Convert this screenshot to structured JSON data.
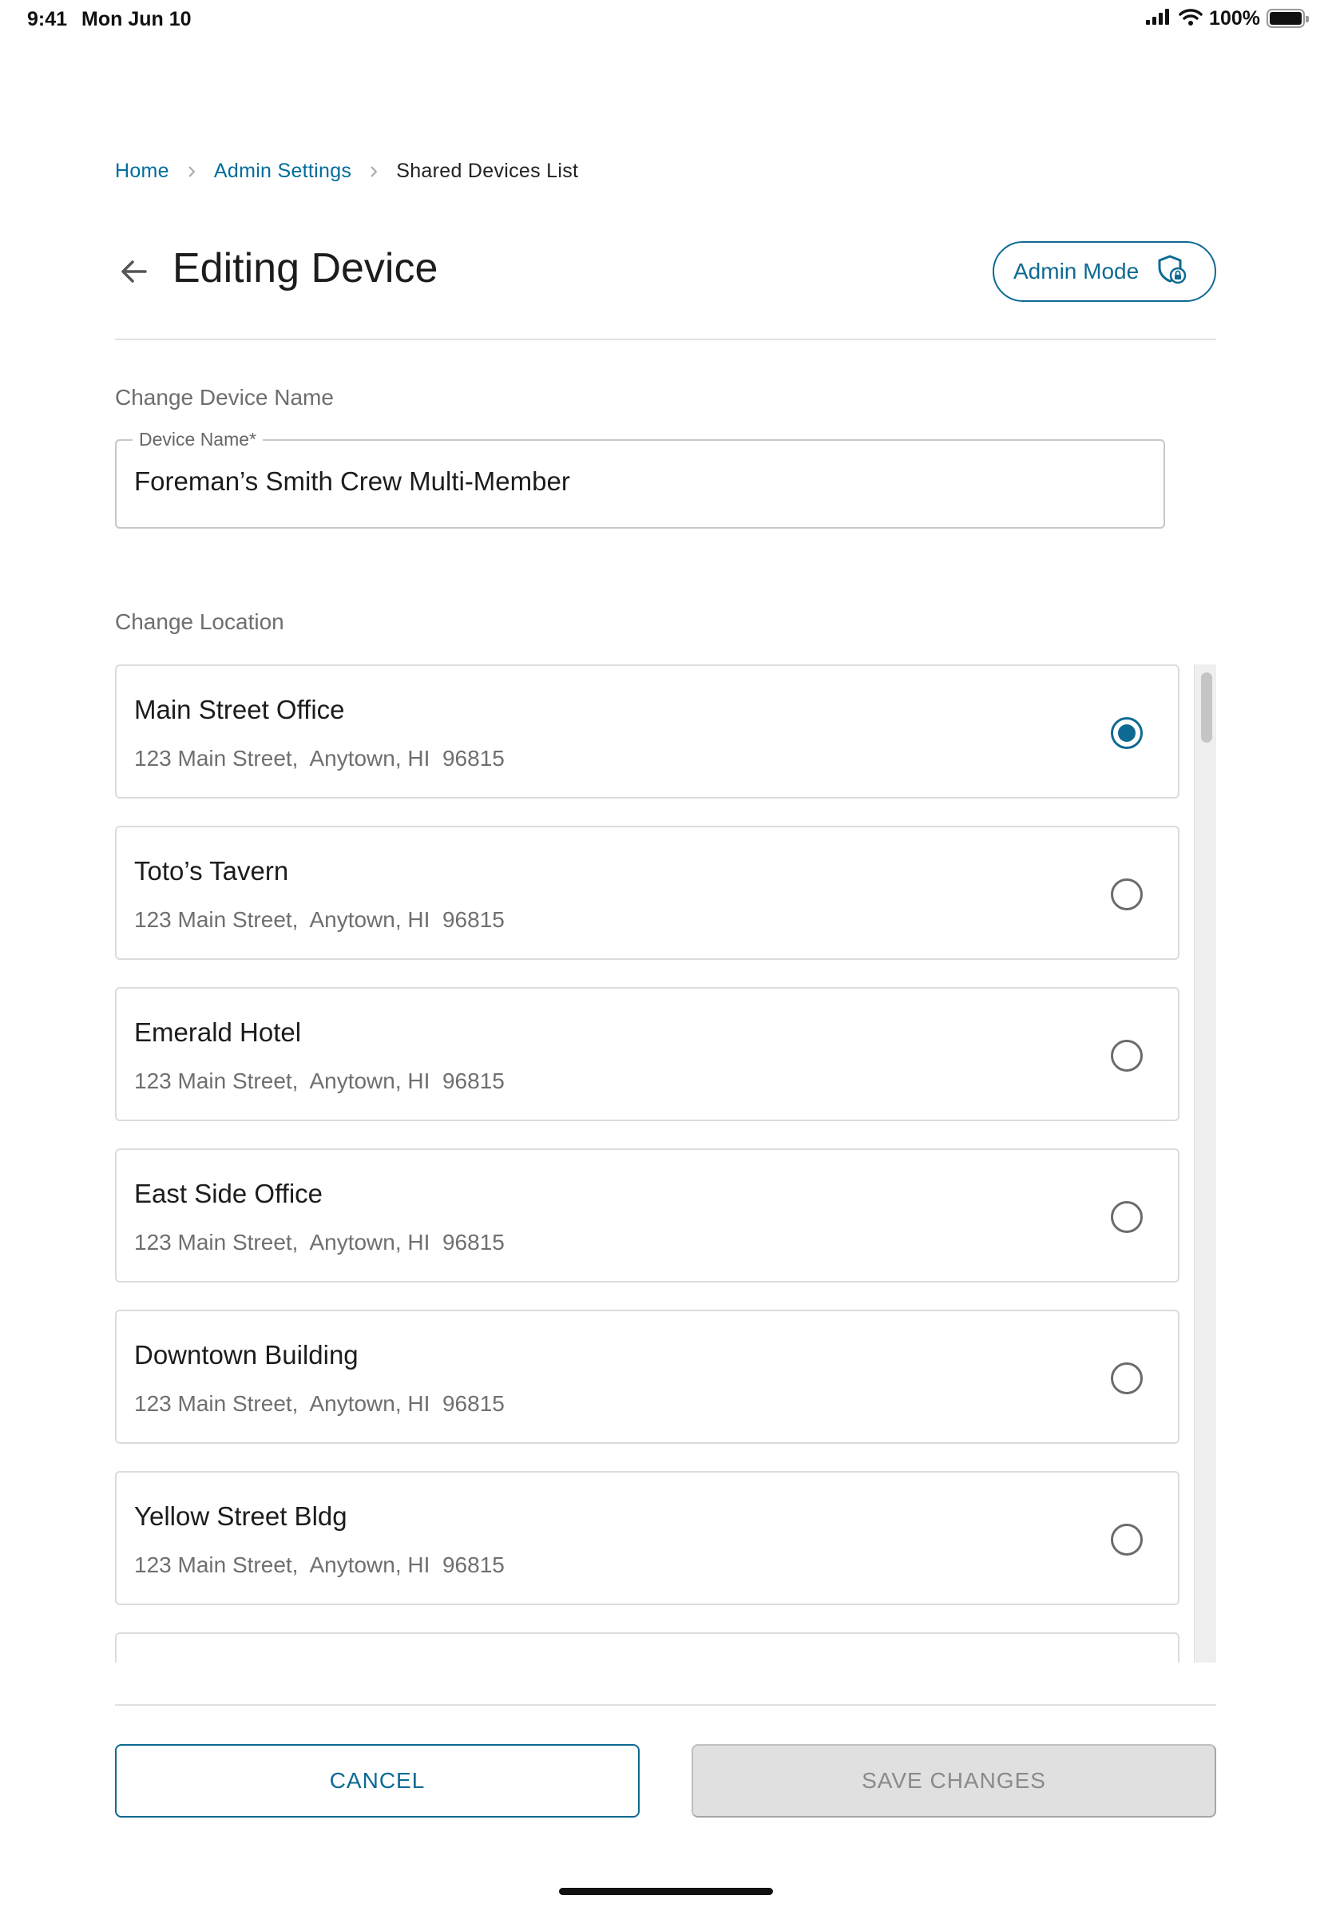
{
  "status_bar": {
    "time": "9:41",
    "date": "Mon Jun 10",
    "battery": "100%",
    "icons": [
      "cellular-signal-icon",
      "wifi-icon",
      "battery-icon"
    ]
  },
  "breadcrumb": {
    "items": [
      {
        "label": "Home",
        "link": true
      },
      {
        "label": "Admin Settings",
        "link": true
      },
      {
        "label": "Shared Devices List",
        "link": false
      }
    ]
  },
  "header": {
    "title": "Editing Device",
    "back_icon": "arrow-left-icon",
    "admin_mode_label": "Admin Mode",
    "admin_mode_icon": "shield-lock-icon"
  },
  "device_name": {
    "section_label": "Change Device Name",
    "field_label": "Device Name*",
    "value": "Foreman’s Smith Crew Multi-Member"
  },
  "location": {
    "section_label": "Change Location",
    "selected_index": 0,
    "items": [
      {
        "name": "Main Street Office",
        "address": "123 Main Street,  Anytown, HI  96815"
      },
      {
        "name": "Toto’s Tavern",
        "address": "123 Main Street,  Anytown, HI  96815"
      },
      {
        "name": "Emerald Hotel",
        "address": "123 Main Street,  Anytown, HI  96815"
      },
      {
        "name": "East Side Office",
        "address": "123 Main Street,  Anytown, HI  96815"
      },
      {
        "name": "Downtown Building",
        "address": "123 Main Street,  Anytown, HI  96815"
      },
      {
        "name": "Yellow Street Bldg",
        "address": "123 Main Street,  Anytown, HI  96815"
      }
    ]
  },
  "footer": {
    "cancel_label": "CANCEL",
    "save_label": "SAVE CHANGES"
  },
  "colors": {
    "accent": "#0e6a92",
    "link": "#006d9c",
    "disabled_bg": "#e0e0e0",
    "disabled_text": "#8a8a8a"
  }
}
